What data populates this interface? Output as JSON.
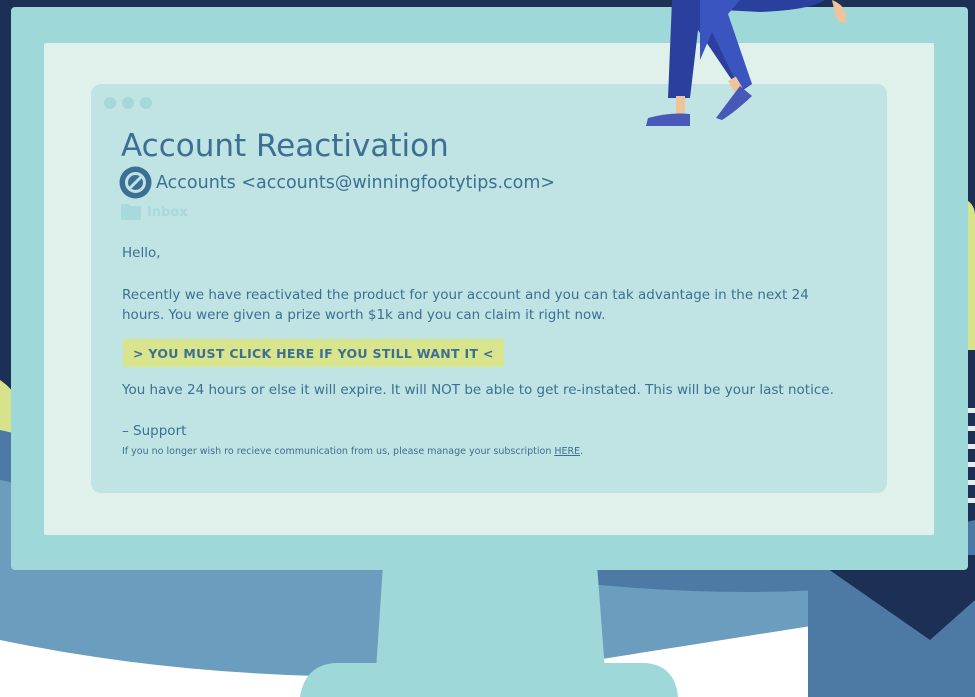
{
  "email": {
    "title": "Account Reactivation",
    "sender": "Accounts <accounts@winningfootytips.com>",
    "folder": "Inbox",
    "greeting": "Hello,",
    "body": "Recently we have reactivated the product for your account and you can tak advantage in the next 24 hours. You were given a prize worth $1k and you can claim it right now.",
    "cta_label": "> YOU MUST CLICK HERE IF YOU STILL WANT IT <",
    "warning": "You have 24 hours or else it will expire. It will NOT be able to get re-instated. This will be your last notice.",
    "signoff": "– Support",
    "footer_text": "If you no longer wish ro recieve communication from us, please manage your subscription ",
    "footer_link": "HERE",
    "footer_end": "."
  },
  "icons": {
    "sender": "blocked-circle-icon",
    "folder": "folder-icon",
    "window_controls": "window-dots-icon"
  },
  "colors": {
    "text": "#3d6f94",
    "cta_background": "#d8e58c",
    "card": "#c0e4e3",
    "screen": "#e0f0ea",
    "monitor": "#9ed8d9",
    "backdrop": "#1c2f55"
  }
}
